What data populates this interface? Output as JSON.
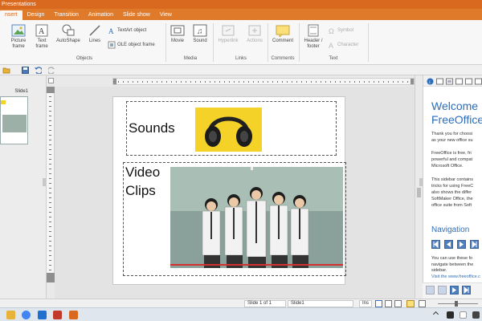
{
  "window": {
    "title": "Presentations"
  },
  "tabs": [
    {
      "label": "nsert",
      "active": true
    },
    {
      "label": "Design",
      "active": false
    },
    {
      "label": "Transition",
      "active": false
    },
    {
      "label": "Animation",
      "active": false
    },
    {
      "label": "Slide show",
      "active": false
    },
    {
      "label": "View",
      "active": false
    }
  ],
  "ribbon": {
    "objects": {
      "picture_frame": "Picture frame",
      "text_frame": "Text frame",
      "autoshape": "AutoShape",
      "lines": "Lines",
      "textart": "TextArt object",
      "ole": "OLE object frame",
      "label": "Objects"
    },
    "media": {
      "movie": "Movie",
      "sound": "Sound",
      "label": "Media"
    },
    "links": {
      "hyperlink": "Hyperlink",
      "actions": "Actions",
      "label": "Links"
    },
    "comments": {
      "comment": "Comment",
      "label": "Comments"
    },
    "text": {
      "header_footer": "Header / footer",
      "symbol": "Symbol",
      "character": "Character",
      "label": "Text"
    }
  },
  "left_panel": {
    "slide_label": "Slide1"
  },
  "slide": {
    "sounds_text": "Sounds",
    "video_line1": "Video",
    "video_line2": "Clips"
  },
  "sidebar": {
    "welcome": "Welcome",
    "freeoffice": "FreeOffice",
    "lines": [
      "Thank you for choosi",
      "as your new office su",
      "FreeOffice is free, fri",
      "powerful and compat",
      "Microsoft Office.",
      "This sidebar contains",
      "tricks for using FreeC",
      "also shows the differ",
      "SoftMaker Office, the",
      "office suite from Soft"
    ],
    "navigation": "Navigation",
    "nav_lines": [
      "You can use these fo",
      "navigate between the",
      "sidebar."
    ],
    "link": "Visit the www.freeoffice.c"
  },
  "statusbar": {
    "slide_of": "Slide 1 of 1",
    "slide_name": "Slide1",
    "mode": "Ins"
  },
  "colors": {
    "titlebar": "#d9691f",
    "tab_bar": "#e07a2b",
    "sidebar_heading": "#2a6ebb"
  }
}
